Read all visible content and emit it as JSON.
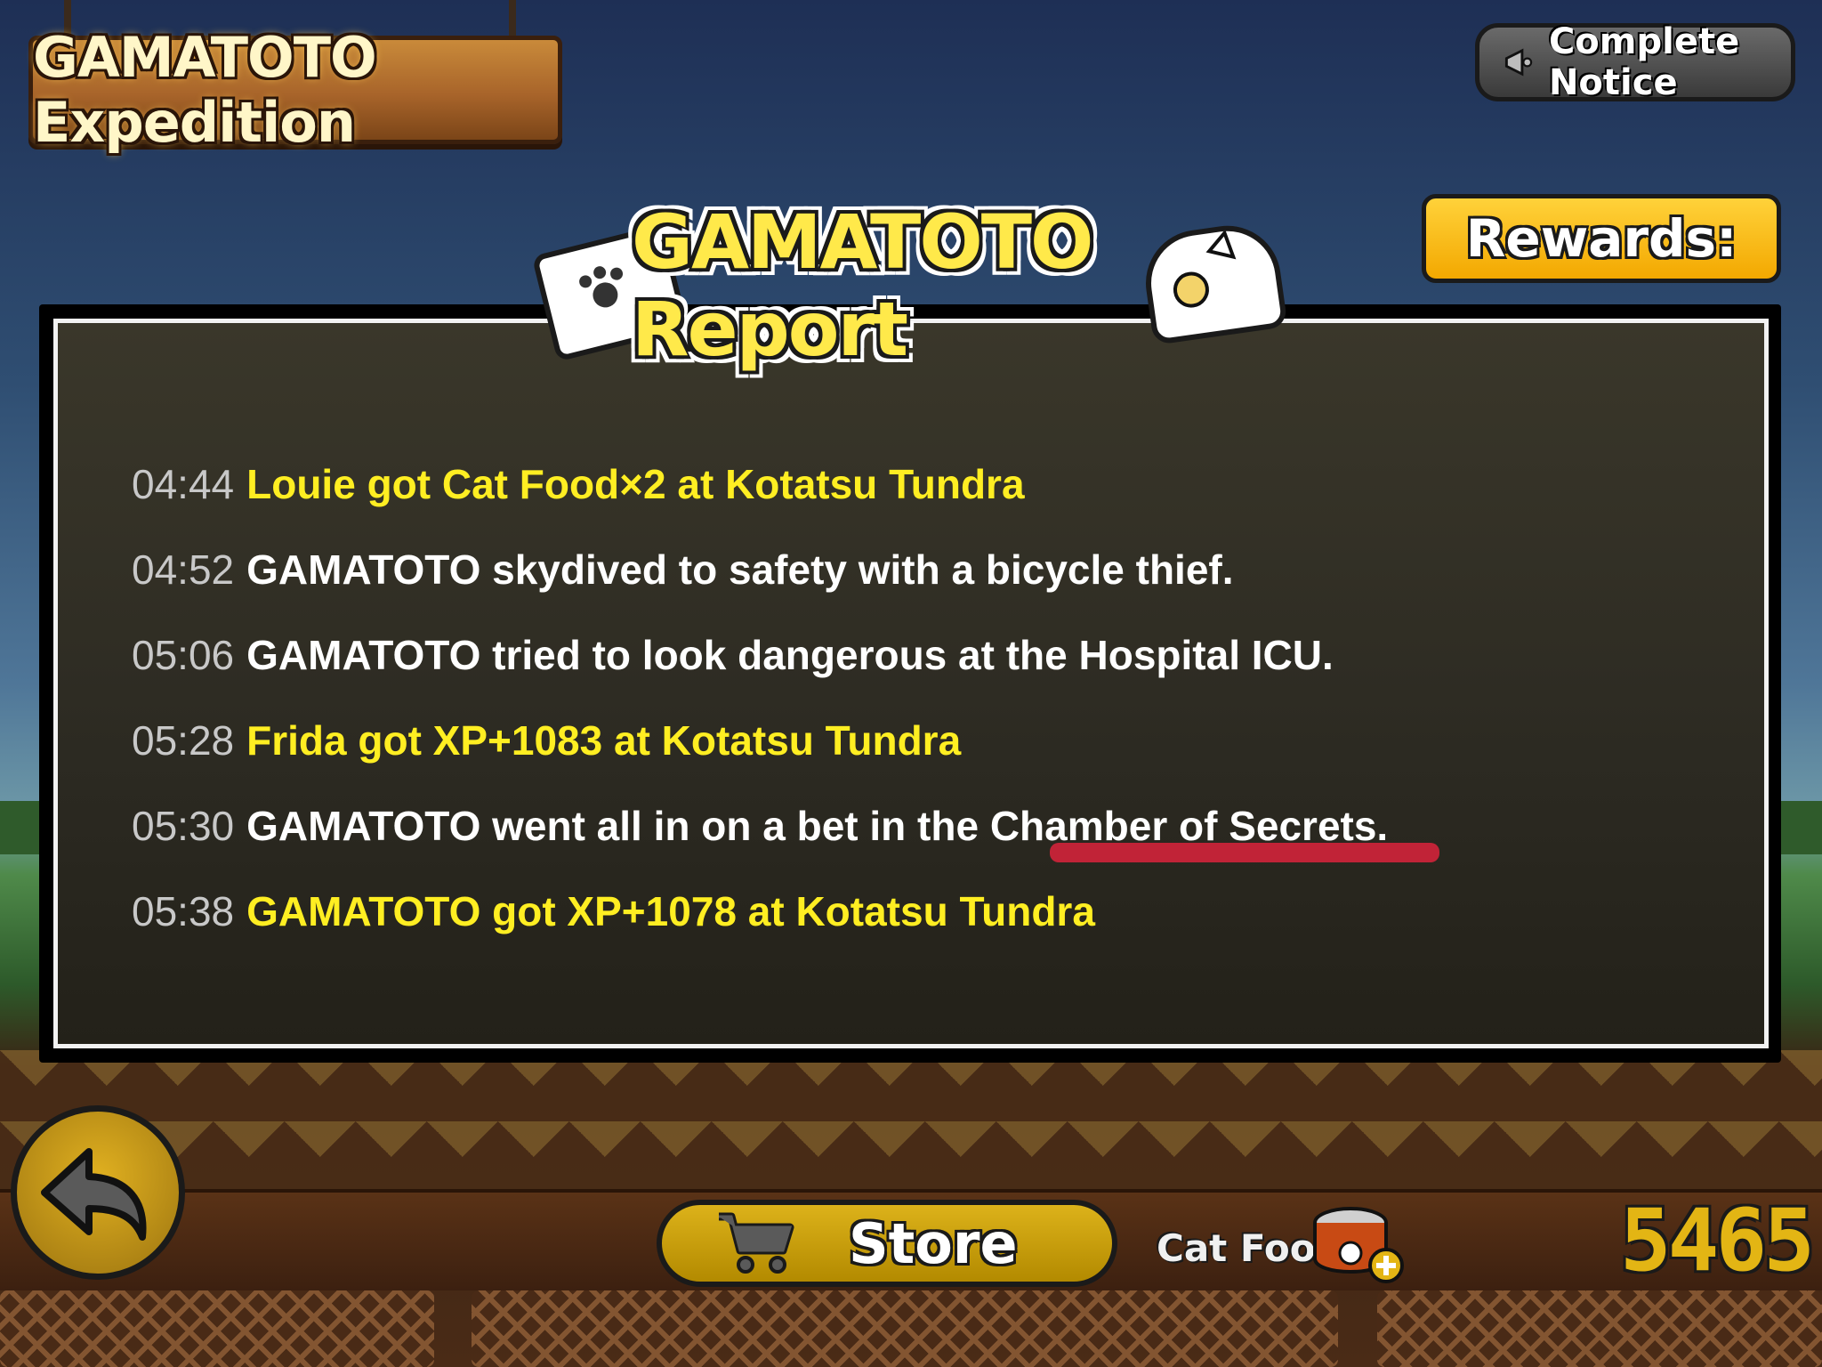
{
  "header": {
    "title": "GAMATOTO Expedition",
    "notice_label": "Complete Notice"
  },
  "rewards": {
    "label": "Rewards:"
  },
  "report": {
    "title": "GAMATOTO Report",
    "entries": [
      {
        "time": "04:44",
        "text": "Louie got Cat Food×2 at Kotatsu Tundra",
        "color": "yellow"
      },
      {
        "time": "04:52",
        "text": "GAMATOTO skydived to safety with a bicycle thief.",
        "color": "white"
      },
      {
        "time": "05:06",
        "text": "GAMATOTO tried to look dangerous at the Hospital ICU.",
        "color": "white"
      },
      {
        "time": "05:28",
        "text": "Frida got XP+1083 at Kotatsu Tundra",
        "color": "yellow"
      },
      {
        "time": "05:30",
        "text": "GAMATOTO went all in on a bet in the Chamber of Secrets.",
        "color": "white"
      },
      {
        "time": "05:38",
        "text": "GAMATOTO got XP+1078 at Kotatsu Tundra",
        "color": "yellow"
      }
    ]
  },
  "bottom_bar": {
    "store_label": "Store",
    "cat_food_label": "Cat Food",
    "cat_food_count": "5465"
  },
  "icons": [
    "bell-icon",
    "back-arrow-icon",
    "cart-icon",
    "cat-food-can-icon",
    "plus-icon",
    "notebook-icon",
    "helmet-icon"
  ],
  "colors": {
    "highlight_yellow": "#ffee22",
    "time_gray": "#c8c8c8",
    "button_gold": "#f3a800",
    "annotation_red": "#d2233a"
  }
}
